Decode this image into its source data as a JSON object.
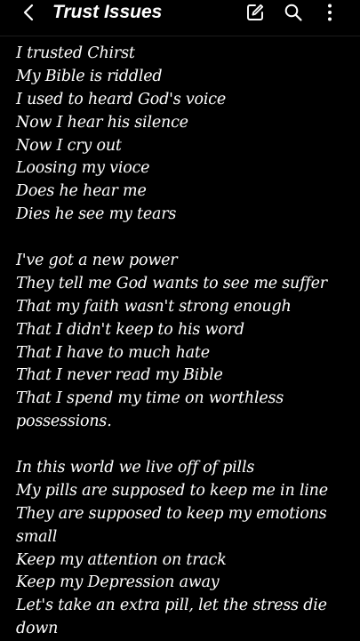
{
  "header": {
    "title": "Trust Issues",
    "icons": [
      "back-arrow-icon",
      "edit-icon",
      "search-icon",
      "more-vertical-icon"
    ]
  },
  "note": {
    "stanzas": [
      {
        "lines": [
          "I trusted Chirst",
          "My Bible is riddled",
          "I used to heard God's voice",
          "Now I hear his silence",
          "Now I cry out",
          "Loosing my vioce",
          "Does he hear me",
          "Dies he see my tears"
        ]
      },
      {
        "lines": [
          "I've got a new power",
          "They tell me God wants to see me suffer",
          "That my faith wasn't strong enough",
          "That I didn't keep to his word",
          "That I have to much hate",
          "That I never read my Bible",
          "That I spend my time on worthless",
          "possessions."
        ]
      },
      {
        "lines": [
          "In this world we live off of pills",
          "My pills are supposed to keep me in line",
          "They are supposed to keep my emotions",
          "small",
          "Keep my attention on track",
          "Keep my Depression away",
          "Let's take an extra pill, let the stress die",
          "down"
        ]
      }
    ]
  }
}
